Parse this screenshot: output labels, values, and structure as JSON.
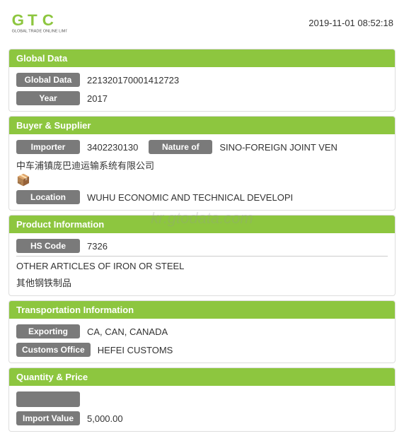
{
  "header": {
    "timestamp": "2019-11-01 08:52:18"
  },
  "sections": {
    "global_data": {
      "title": "Global Data",
      "fields": [
        {
          "label": "Global Data",
          "value": "221320170001412723"
        },
        {
          "label": "Year",
          "value": "2017"
        }
      ]
    },
    "buyer_supplier": {
      "title": "Buyer & Supplier",
      "importer_label": "Importer",
      "importer_value": "3402230130",
      "nature_label": "Nature of",
      "nature_value": "SINO-FOREIGN JOINT VEN",
      "company_name": "中车浦镇庞巴迪运输系统有限公司",
      "company_icon": "📦",
      "location_label": "Location",
      "location_value": "WUHU ECONOMIC AND TECHNICAL DEVELOPI"
    },
    "product_information": {
      "title": "Product Information",
      "hs_label": "HS Code",
      "hs_value": "7326",
      "description_en": "OTHER ARTICLES OF IRON OR STEEL",
      "description_cn": "其他钢铁制品"
    },
    "transportation": {
      "title": "Transportation Information",
      "exporting_label": "Exporting",
      "exporting_value": "CA, CAN, CANADA",
      "customs_label": "Customs Office",
      "customs_value": "HEFEI CUSTOMS"
    },
    "quantity_price": {
      "title": "Quantity & Price",
      "hidden_label": "",
      "import_label": "Import Value",
      "import_value": "5,000.00"
    }
  },
  "watermark": "kr.gtodata.com"
}
